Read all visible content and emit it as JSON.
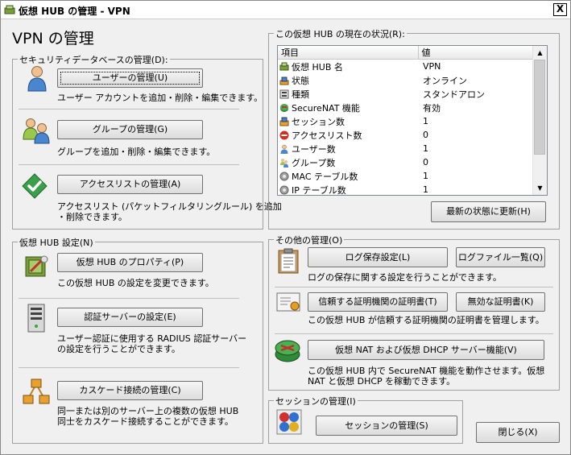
{
  "window": {
    "title": "仮想 HUB の管理 - VPN",
    "close_label": "X"
  },
  "heading": "VPN の管理",
  "security_db": {
    "label": "セキュリティデータベースの管理(D):",
    "users_button": "ユーザーの管理(U)",
    "users_desc": "ユーザー アカウントを追加・削除・編集できます。",
    "groups_button": "グループの管理(G)",
    "groups_desc": "グループを追加・削除・編集できます。",
    "acl_button": "アクセスリストの管理(A)",
    "acl_desc_1": "アクセスリスト (パケットフィルタリングルール) を追加",
    "acl_desc_2": "・削除できます。"
  },
  "hub_settings": {
    "label": "仮想 HUB 設定(N)",
    "props_button": "仮想 HUB のプロパティ(P)",
    "props_desc": "この仮想 HUB の設定を変更できます。",
    "radius_button": "認証サーバーの設定(E)",
    "radius_desc_1": "ユーザー認証に使用する RADIUS 認証サーバー",
    "radius_desc_2": "の設定を行うことができます。",
    "cascade_button": "カスケード接続の管理(C)",
    "cascade_desc_1": "同一または別のサーバー上の複数の仮想 HUB",
    "cascade_desc_2": "同士をカスケード接続することができます。"
  },
  "status": {
    "label": "この仮想 HUB の現在の状況(R):",
    "columns": [
      "項目",
      "値"
    ],
    "rows": [
      {
        "item": "仮想 HUB 名",
        "value": "VPN",
        "icon": "hub-icon"
      },
      {
        "item": "状態",
        "value": "オンライン",
        "icon": "online-icon"
      },
      {
        "item": "種類",
        "value": "スタンドアロン",
        "icon": "type-icon"
      },
      {
        "item": "SecureNAT 機能",
        "value": "有効",
        "icon": "router-icon"
      },
      {
        "item": "セッション数",
        "value": "1",
        "icon": "session-icon"
      },
      {
        "item": "アクセスリスト数",
        "value": "0",
        "icon": "stop-icon"
      },
      {
        "item": "ユーザー数",
        "value": "1",
        "icon": "user-icon"
      },
      {
        "item": "グループ数",
        "value": "0",
        "icon": "group-icon"
      },
      {
        "item": "MAC テーブル数",
        "value": "1",
        "icon": "gear-icon"
      },
      {
        "item": "IP テーブル数",
        "value": "1",
        "icon": "gear-icon"
      }
    ],
    "refresh_button": "最新の状態に更新(H)"
  },
  "other": {
    "label": "その他の管理(O)",
    "log_button": "ログ保存設定(L)",
    "logfiles_button": "ログファイル一覧(Q)",
    "log_desc": "ログの保存に関する設定を行うことができます。",
    "trusted_ca_button": "信頼する証明機関の証明書(T)",
    "invalid_cert_button": "無効な証明書(K)",
    "cert_desc": "この仮想 HUB が信頼する証明機関の証明書を管理します。",
    "nat_button": "仮想 NAT および仮想 DHCP サーバー機能(V)",
    "nat_desc_1": "この仮想 HUB 内で SecureNAT 機能を動作させます。仮想",
    "nat_desc_2": "NAT と仮想 DHCP を稼動できます。"
  },
  "sessions": {
    "label": "セッションの管理(I)",
    "button": "セッションの管理(S)"
  },
  "close_button": "閉じる(X)"
}
